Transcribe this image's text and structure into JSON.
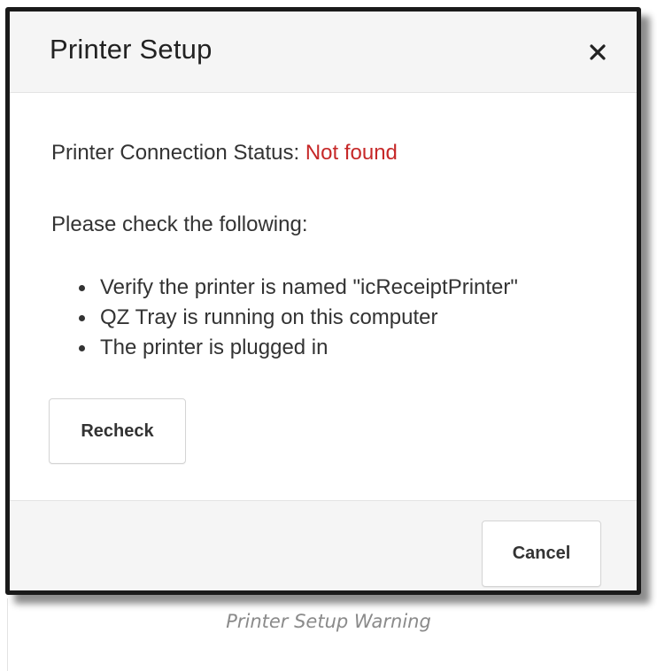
{
  "dialog": {
    "title": "Printer Setup",
    "close_icon": "close-icon",
    "status": {
      "label": "Printer Connection Status:",
      "value": "Not found",
      "value_color": "#c62828"
    },
    "check_heading": "Please check the following:",
    "checklist": [
      "Verify the printer is named \"icReceiptPrinter\"",
      "QZ Tray is running on this computer",
      "The printer is plugged in"
    ],
    "recheck_label": "Recheck",
    "cancel_label": "Cancel"
  },
  "caption": "Printer Setup Warning"
}
